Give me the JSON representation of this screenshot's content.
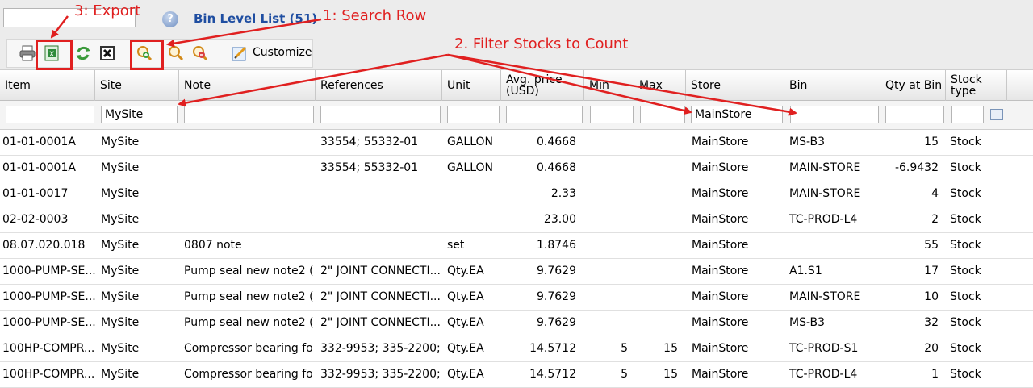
{
  "header": {
    "title": "Bin Level List (51)"
  },
  "toolbar": {
    "customize_label": "Customize"
  },
  "annotations": {
    "export": "3: Export",
    "search_row": "1: Search Row",
    "filter": "2. Filter Stocks to Count"
  },
  "columns": [
    "Item",
    "Site",
    "Note",
    "References",
    "Unit",
    "Avg. price (USD)",
    "Min",
    "Max",
    "Store",
    "Bin",
    "Qty at Bin",
    "Stock type"
  ],
  "filters": {
    "item": "",
    "site": "MySite",
    "note": "",
    "references": "",
    "unit": "",
    "avg_price": "",
    "min": "",
    "max": "",
    "store": "MainStore",
    "bin": "",
    "qty": "",
    "stock_type": ""
  },
  "rows": [
    {
      "item": "01-01-0001A",
      "site": "MySite",
      "note": "",
      "references": "33554; 55332-01",
      "unit": "GALLON",
      "avg_price": "0.4668",
      "min": "",
      "max": "",
      "store": "MainStore",
      "bin": "MS-B3",
      "qty": "15",
      "stock_type": "Stock"
    },
    {
      "item": "01-01-0001A",
      "site": "MySite",
      "note": "",
      "references": "33554; 55332-01",
      "unit": "GALLON",
      "avg_price": "0.4668",
      "min": "",
      "max": "",
      "store": "MainStore",
      "bin": "MAIN-STORE",
      "qty": "-6.9432",
      "stock_type": "Stock"
    },
    {
      "item": "01-01-0017",
      "site": "MySite",
      "note": "",
      "references": "",
      "unit": "",
      "avg_price": "2.33",
      "min": "",
      "max": "",
      "store": "MainStore",
      "bin": "MAIN-STORE",
      "qty": "4",
      "stock_type": "Stock"
    },
    {
      "item": "02-02-0003",
      "site": "MySite",
      "note": "",
      "references": "",
      "unit": "",
      "avg_price": "23.00",
      "min": "",
      "max": "",
      "store": "MainStore",
      "bin": "TC-PROD-L4",
      "qty": "2",
      "stock_type": "Stock"
    },
    {
      "item": "08.07.020.018",
      "site": "MySite",
      "note": "0807 note",
      "references": "",
      "unit": "set",
      "avg_price": "1.8746",
      "min": "",
      "max": "",
      "store": "MainStore",
      "bin": "",
      "qty": "55",
      "stock_type": "Stock"
    },
    {
      "item": "1000-PUMP-SE...",
      "site": "MySite",
      "note": "Pump seal new note2 (...",
      "references": "2\" JOINT CONNECTI...",
      "unit": "Qty.EA",
      "avg_price": "9.7629",
      "min": "",
      "max": "",
      "store": "MainStore",
      "bin": "A1.S1",
      "qty": "17",
      "stock_type": "Stock"
    },
    {
      "item": "1000-PUMP-SE...",
      "site": "MySite",
      "note": "Pump seal new note2 (...",
      "references": "2\" JOINT CONNECTI...",
      "unit": "Qty.EA",
      "avg_price": "9.7629",
      "min": "",
      "max": "",
      "store": "MainStore",
      "bin": "MAIN-STORE",
      "qty": "10",
      "stock_type": "Stock"
    },
    {
      "item": "1000-PUMP-SE...",
      "site": "MySite",
      "note": "Pump seal new note2 (...",
      "references": "2\" JOINT CONNECTI...",
      "unit": "Qty.EA",
      "avg_price": "9.7629",
      "min": "",
      "max": "",
      "store": "MainStore",
      "bin": "MS-B3",
      "qty": "32",
      "stock_type": "Stock"
    },
    {
      "item": "100HP-COMPR...",
      "site": "MySite",
      "note": "Compressor bearing fo...",
      "references": "332-9953; 335-2200;...",
      "unit": "Qty.EA",
      "avg_price": "14.5712",
      "min": "5",
      "max": "15",
      "store": "MainStore",
      "bin": "TC-PROD-S1",
      "qty": "20",
      "stock_type": "Stock"
    },
    {
      "item": "100HP-COMPR...",
      "site": "MySite",
      "note": "Compressor bearing fo...",
      "references": "332-9953; 335-2200;...",
      "unit": "Qty.EA",
      "avg_price": "14.5712",
      "min": "5",
      "max": "15",
      "store": "MainStore",
      "bin": "TC-PROD-L4",
      "qty": "1",
      "stock_type": "Stock"
    }
  ]
}
